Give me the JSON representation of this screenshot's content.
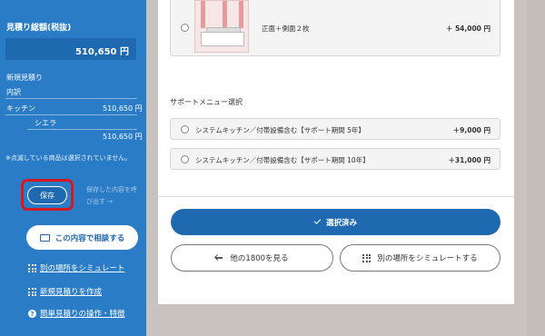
{
  "sidebar": {
    "title": "見積り総額(税抜)",
    "total": "510,650 円",
    "new_estimate": "新規見積り",
    "breakdown": "内訳",
    "items": [
      {
        "name": "キッチン",
        "price": "510,650 円"
      },
      {
        "name": "シエラ",
        "price": "510,650 円"
      }
    ],
    "note": "※点滅している商品は選択されていません。",
    "save_label": "保存",
    "restore_label": "保存した内容を呼び出す →",
    "consult_label": "この内容で相談する",
    "links": [
      {
        "label": "別の場所をシミュレート",
        "icon": "grid-icon"
      },
      {
        "label": "新規見積りを作成",
        "icon": "grid-icon"
      },
      {
        "label": "簡単見積りの操作・特徴",
        "icon": "help-icon"
      }
    ]
  },
  "main": {
    "image_option": {
      "label": "正面＋側面２枚",
      "price": "＋ 54,000 円"
    },
    "support_title": "サポートメニュー選択",
    "support_options": [
      {
        "label": "システムキッチン／付帯設備含む【サポート期間 5年】",
        "price": "＋9,000 円"
      },
      {
        "label": "システムキッチン／付帯設備含む【サポート期間 10年】",
        "price": "＋31,000 円"
      }
    ],
    "selected_label": "選択済み",
    "back_label": "他の1800を見る",
    "simulate_label": "別の場所をシミュレートする"
  },
  "colors": {
    "sidebar": "#2a7cc7",
    "primary": "#1f69b0",
    "highlight": "#d21a23"
  }
}
